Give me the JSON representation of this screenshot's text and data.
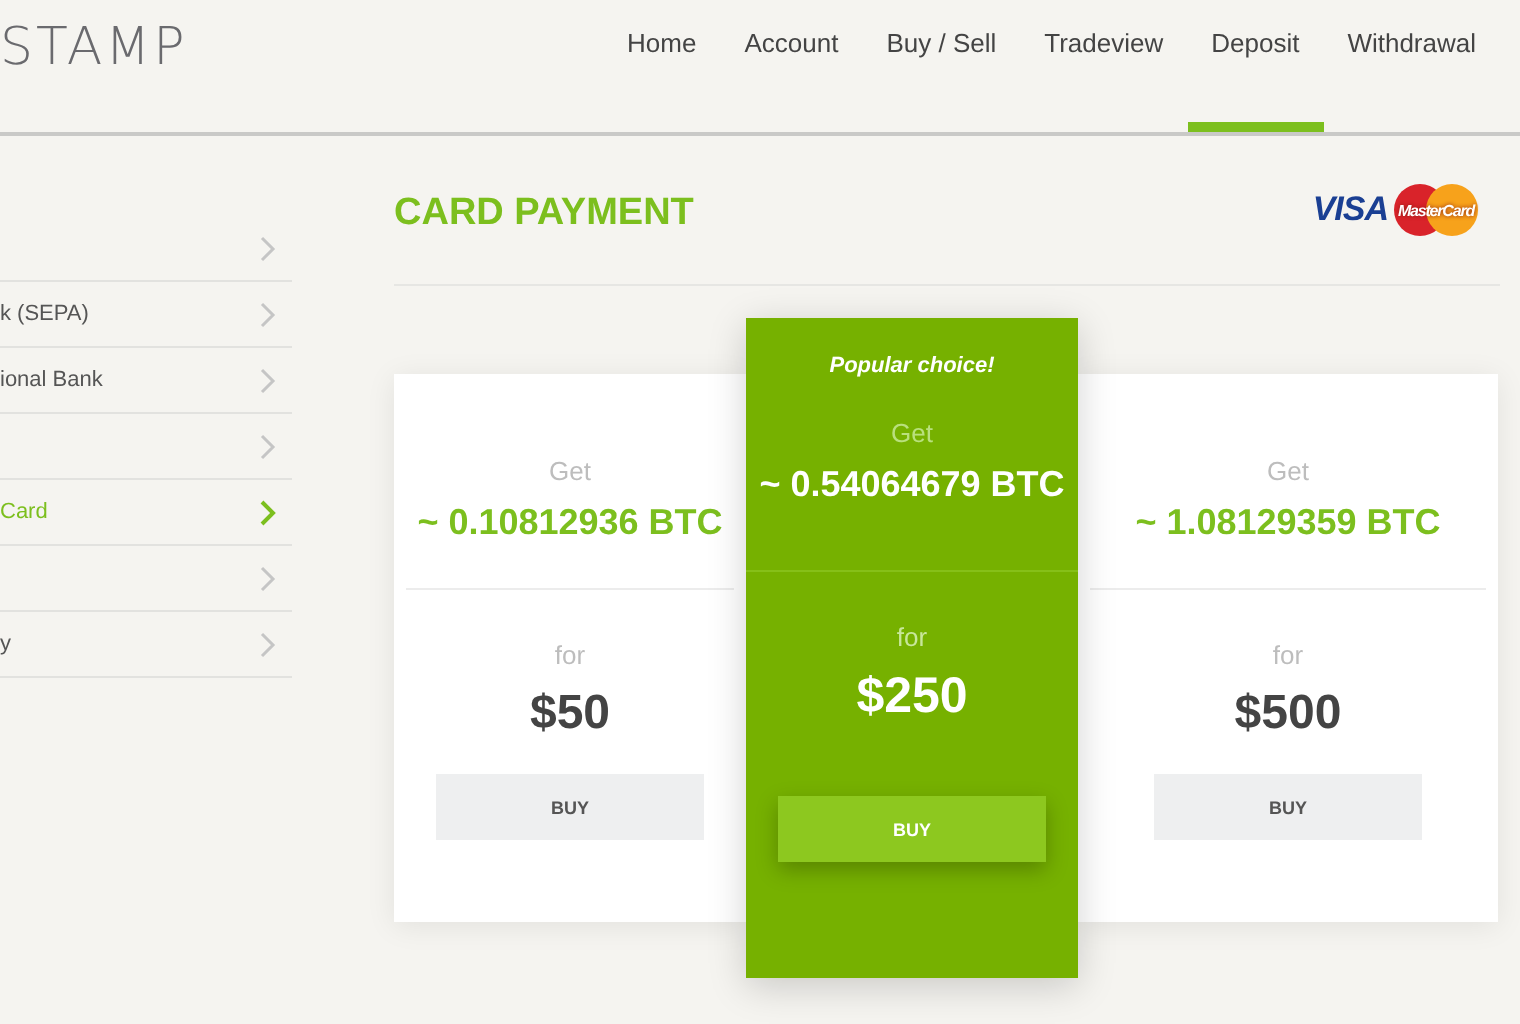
{
  "header": {
    "logo": "STAMP",
    "nav": [
      {
        "label": "Home",
        "selected": false
      },
      {
        "label": "Account",
        "selected": false
      },
      {
        "label": "Buy / Sell",
        "selected": false
      },
      {
        "label": "Tradeview",
        "selected": false
      },
      {
        "label": "Deposit",
        "selected": true
      },
      {
        "label": "Withdrawal",
        "selected": false
      }
    ]
  },
  "sidebar": {
    "items": [
      {
        "selected": false
      },
      {
        "label": "k (SEPA)",
        "selected": false
      },
      {
        "label": "ional Bank",
        "selected": false
      },
      {
        "selected": false
      },
      {
        "label": "Card",
        "selected": true
      },
      {
        "selected": false
      },
      {
        "label": "y",
        "selected": false
      }
    ]
  },
  "main": {
    "title": "CARD PAYMENT",
    "card_logos": [
      "VISA",
      "MasterCard"
    ],
    "offers": [
      {
        "get_label": "Get",
        "amount": "~ 0.10812936 BTC",
        "for_label": "for",
        "price": "$50",
        "button": "BUY",
        "selected": false
      },
      {
        "badge": "Popular choice!",
        "get_label": "Get",
        "amount": "~ 0.54064679 BTC",
        "for_label": "for",
        "price": "$250",
        "button": "BUY",
        "selected": true
      },
      {
        "get_label": "Get",
        "amount": "~ 1.08129359 BTC",
        "for_label": "for",
        "price": "$500",
        "button": "BUY",
        "selected": false
      }
    ]
  }
}
